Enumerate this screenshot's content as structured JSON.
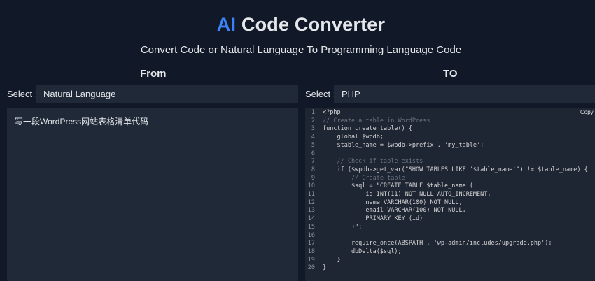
{
  "header": {
    "title_ai": "AI",
    "title_rest": "Code Converter",
    "subtitle": "Convert Code or Natural Language To Programming Language Code"
  },
  "from": {
    "heading": "From",
    "select_label": "Select :",
    "selected": "Natural Language",
    "input_text": "写一段WordPress网站表格清单代码"
  },
  "to": {
    "heading": "TO",
    "select_label": "Select :",
    "selected": "PHP",
    "copy_label": "Copy",
    "code_lines": [
      {
        "n": "1",
        "text": "<?php",
        "color": "#d4d4d4"
      },
      {
        "n": "2",
        "text": "// Create a table in WordPress",
        "color": "#6a737d"
      },
      {
        "n": "3",
        "text": "function create_table() {",
        "color": "#d4d4d4"
      },
      {
        "n": "4",
        "text": "    global $wpdb;",
        "color": "#d4d4d4"
      },
      {
        "n": "5",
        "text": "    $table_name = $wpdb->prefix . 'my_table';",
        "color": "#d4d4d4"
      },
      {
        "n": "6",
        "text": "",
        "color": "#d4d4d4"
      },
      {
        "n": "7",
        "text": "    // Check if table exists",
        "color": "#6a737d"
      },
      {
        "n": "8",
        "text": "    if ($wpdb->get_var(\"SHOW TABLES LIKE '$table_name'\") != $table_name) {",
        "color": "#d4d4d4"
      },
      {
        "n": "9",
        "text": "        // Create table",
        "color": "#6a737d"
      },
      {
        "n": "10",
        "text": "        $sql = \"CREATE TABLE $table_name (",
        "color": "#d4d4d4"
      },
      {
        "n": "11",
        "text": "            id INT(11) NOT NULL AUTO_INCREMENT,",
        "color": "#d4d4d4"
      },
      {
        "n": "12",
        "text": "            name VARCHAR(100) NOT NULL,",
        "color": "#d4d4d4"
      },
      {
        "n": "13",
        "text": "            email VARCHAR(100) NOT NULL,",
        "color": "#d4d4d4"
      },
      {
        "n": "14",
        "text": "            PRIMARY KEY (id)",
        "color": "#d4d4d4"
      },
      {
        "n": "15",
        "text": "        )\";",
        "color": "#d4d4d4"
      },
      {
        "n": "16",
        "text": "",
        "color": "#d4d4d4"
      },
      {
        "n": "17",
        "text": "        require_once(ABSPATH . 'wp-admin/includes/upgrade.php');",
        "color": "#d4d4d4"
      },
      {
        "n": "18",
        "text": "        dbDelta($sql);",
        "color": "#d4d4d4"
      },
      {
        "n": "19",
        "text": "    }",
        "color": "#d4d4d4"
      },
      {
        "n": "20",
        "text": "}",
        "color": "#d4d4d4"
      }
    ]
  },
  "colors": {
    "background": "#111827",
    "accent": "#3b82f6",
    "panel": "#1f2937",
    "comment": "#6a737d"
  }
}
